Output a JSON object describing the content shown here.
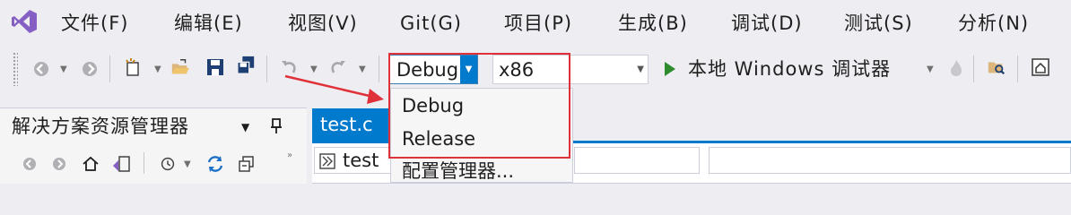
{
  "menu": {
    "items": [
      "文件(F)",
      "编辑(E)",
      "视图(V)",
      "Git(G)",
      "项目(P)",
      "生成(B)",
      "调试(D)",
      "测试(S)",
      "分析(N)"
    ]
  },
  "toolbar": {
    "configuration": {
      "value": "Debug"
    },
    "platform": {
      "value": "x86"
    },
    "run_label": "本地 Windows 调试器"
  },
  "dropdown": {
    "options": [
      "Debug",
      "Release",
      "配置管理器..."
    ]
  },
  "solution_explorer": {
    "title": "解决方案资源管理器"
  },
  "editor": {
    "tab_label": "test.c",
    "nav_project": "test"
  },
  "colors": {
    "accent": "#007acc",
    "highlight_box": "#e0313a",
    "vs_logo": "#865fc5",
    "run_green": "#2e8b2e"
  }
}
